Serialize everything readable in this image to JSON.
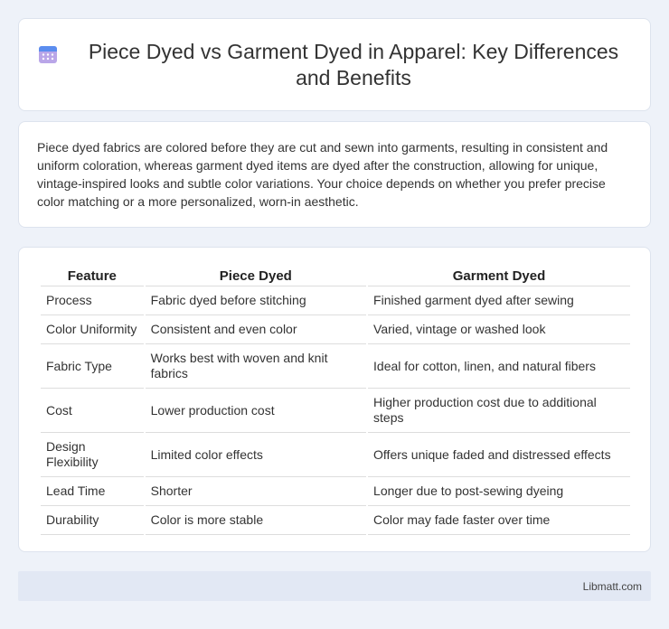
{
  "header": {
    "icon": "calendar-icon",
    "title": "Piece Dyed vs Garment Dyed in Apparel: Key Differences and Benefits"
  },
  "intro": {
    "text": "Piece dyed fabrics are colored before they are cut and sewn into garments, resulting in consistent and uniform coloration, whereas garment dyed items are dyed after the construction, allowing for unique, vintage-inspired looks and subtle color variations. Your choice depends on whether you prefer precise color matching or a more personalized, worn-in aesthetic."
  },
  "table": {
    "headers": [
      "Feature",
      "Piece Dyed",
      "Garment Dyed"
    ],
    "rows": [
      [
        "Process",
        "Fabric dyed before stitching",
        "Finished garment dyed after sewing"
      ],
      [
        "Color Uniformity",
        "Consistent and even color",
        "Varied, vintage or washed look"
      ],
      [
        "Fabric Type",
        "Works best with woven and knit fabrics",
        "Ideal for cotton, linen, and natural fibers"
      ],
      [
        "Cost",
        "Lower production cost",
        "Higher production cost due to additional steps"
      ],
      [
        "Design Flexibility",
        "Limited color effects",
        "Offers unique faded and distressed effects"
      ],
      [
        "Lead Time",
        "Shorter",
        "Longer due to post-sewing dyeing"
      ],
      [
        "Durability",
        "Color is more stable",
        "Color may fade faster over time"
      ]
    ]
  },
  "footer": {
    "text": "Libmatt.com"
  }
}
